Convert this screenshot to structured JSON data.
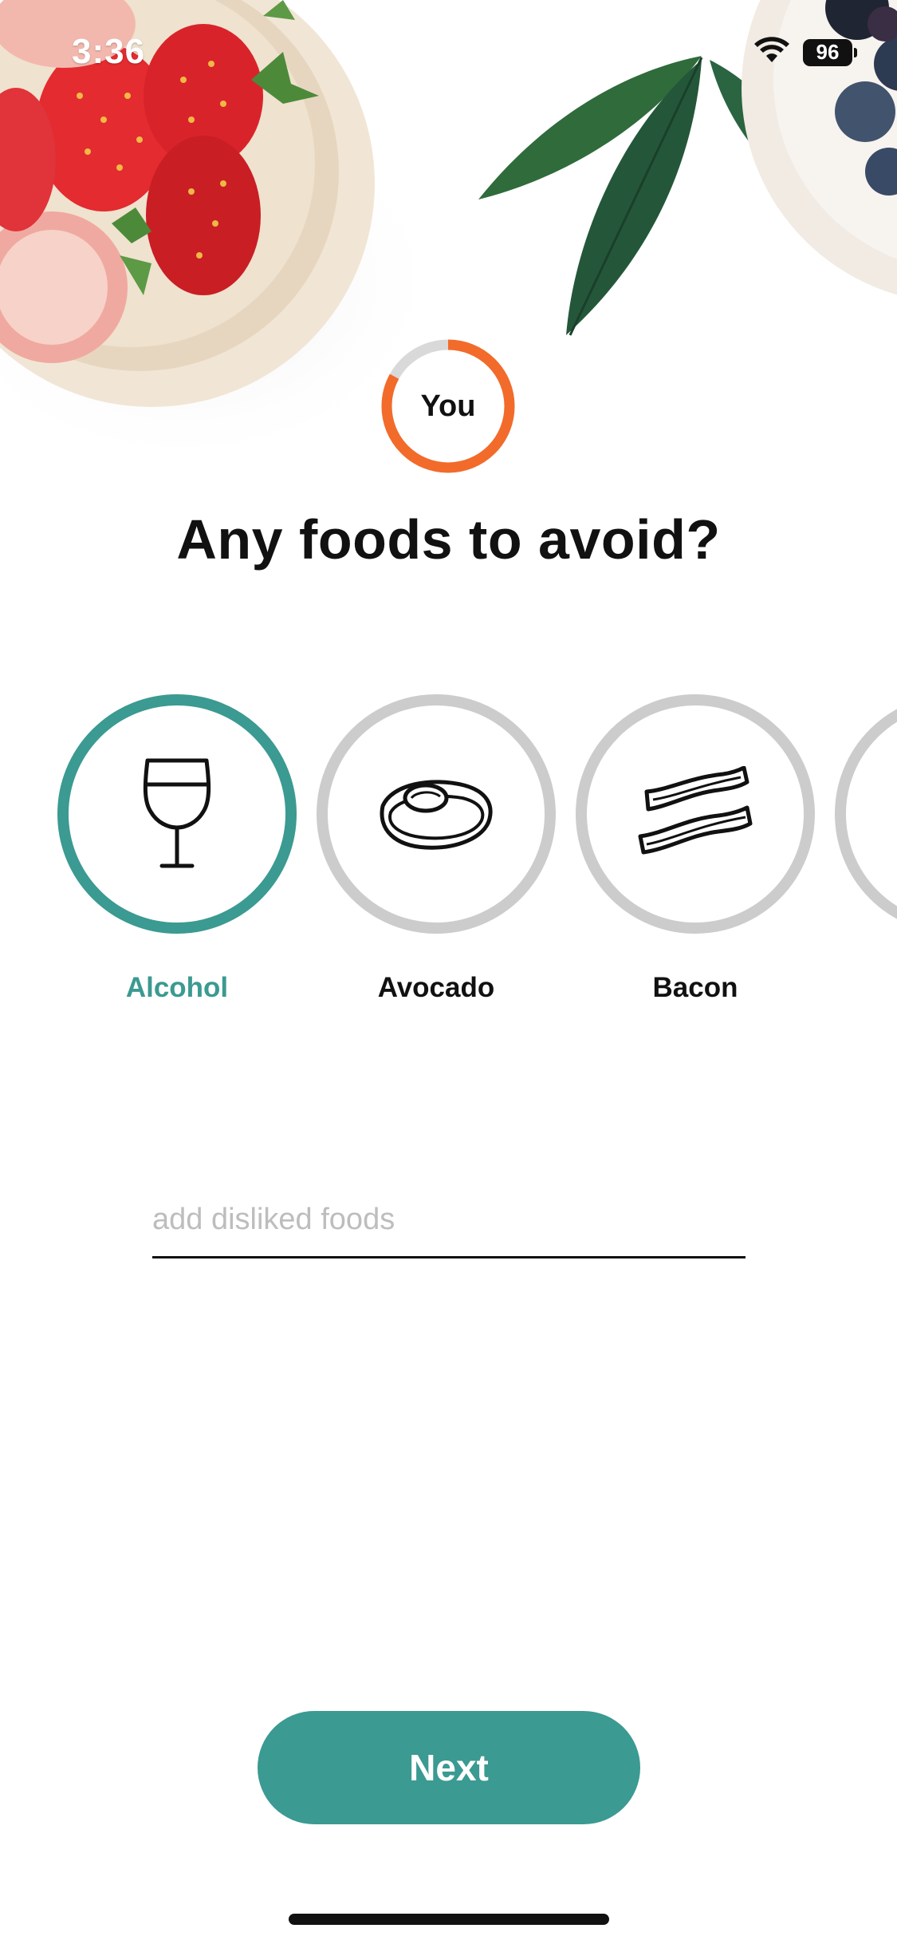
{
  "status_bar": {
    "time": "3:36",
    "battery_level": "96",
    "icons": [
      "wifi-icon",
      "battery-icon"
    ]
  },
  "progress": {
    "label": "You",
    "fraction": 0.83,
    "color": "#f26b2a",
    "track_color": "#d9d9d9"
  },
  "title": "Any foods to avoid?",
  "foods": [
    {
      "label": "Alcohol",
      "icon": "wine-glass-icon",
      "selected": true
    },
    {
      "label": "Avocado",
      "icon": "avocado-icon",
      "selected": false
    },
    {
      "label": "Bacon",
      "icon": "bacon-icon",
      "selected": false
    }
  ],
  "disliked_input": {
    "placeholder": "add disliked foods",
    "value": ""
  },
  "next_button": {
    "label": "Next"
  },
  "colors": {
    "accent": "#3b9a91",
    "unselected_ring": "#cccccc",
    "progress": "#f26b2a"
  }
}
